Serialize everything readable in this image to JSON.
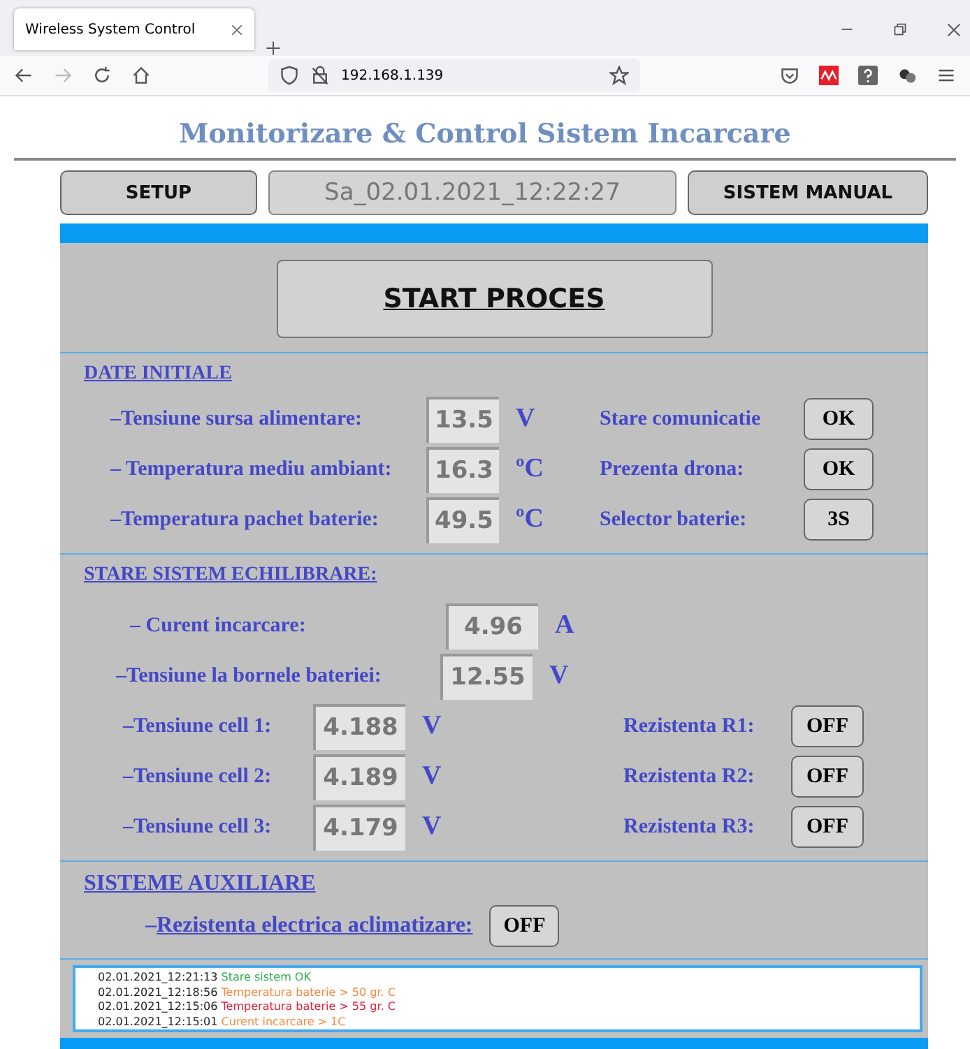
{
  "browser": {
    "tab_title": "Wireless System Control",
    "url": "192.168.1.139"
  },
  "title": "Monitorizare & Control Sistem Incarcare",
  "header": {
    "setup": "SETUP",
    "datetime": "Sa_02.01.2021_12:22:27",
    "manual": "SISTEM MANUAL"
  },
  "start_button": "START PROCES",
  "initial": {
    "heading": "DATE INITIALE",
    "rows": [
      {
        "label": "–Tensiune sursa alimentare:",
        "value": "13.5",
        "unit": "V",
        "status_label": "Stare comunicatie",
        "status": "OK"
      },
      {
        "label": "– Temperatura mediu ambiant:",
        "value": "16.3",
        "unit": "ºC",
        "status_label": "Prezenta drona:",
        "status": "OK"
      },
      {
        "label": "–Temperatura pachet baterie:",
        "value": "49.5",
        "unit": "ºC",
        "status_label": "Selector baterie:",
        "status": "3S"
      }
    ]
  },
  "balance": {
    "heading": "STARE SISTEM ECHILIBRARE:",
    "measurements": [
      {
        "label": "– Curent incarcare:",
        "value": "4.96",
        "unit": "A"
      },
      {
        "label": "–Tensiune la bornele bateriei:",
        "value": "12.55",
        "unit": "V"
      }
    ],
    "cells": [
      {
        "label": "–Tensiune cell 1:",
        "value": "4.188",
        "unit": "V",
        "resistor_label": "Rezistenta R1:",
        "resistor_state": "OFF"
      },
      {
        "label": "–Tensiune cell 2:",
        "value": "4.189",
        "unit": "V",
        "resistor_label": "Rezistenta R2:",
        "resistor_state": "OFF"
      },
      {
        "label": "–Tensiune cell 3:",
        "value": "4.179",
        "unit": "V",
        "resistor_label": "Rezistenta R3:",
        "resistor_state": "OFF"
      }
    ]
  },
  "auxiliary": {
    "heading": "SISTEME AUXILIARE",
    "dash": "–",
    "label": "Rezistenta electrica aclimatizare:",
    "state": "OFF"
  },
  "log": [
    {
      "time": "02.01.2021_12:21:13",
      "message": "Stare sistem OK",
      "color": "#2fae4e"
    },
    {
      "time": "02.01.2021_12:18:56",
      "message": "Temperatura baterie > 50 gr. C",
      "color": "#f7883f"
    },
    {
      "time": "02.01.2021_12:15:06",
      "message": "Temperatura baterie > 55 gr. C",
      "color": "#e5203a"
    },
    {
      "time": "02.01.2021_12:15:01",
      "message": "Curent incarcare > 1C",
      "color": "#f7883f"
    }
  ]
}
